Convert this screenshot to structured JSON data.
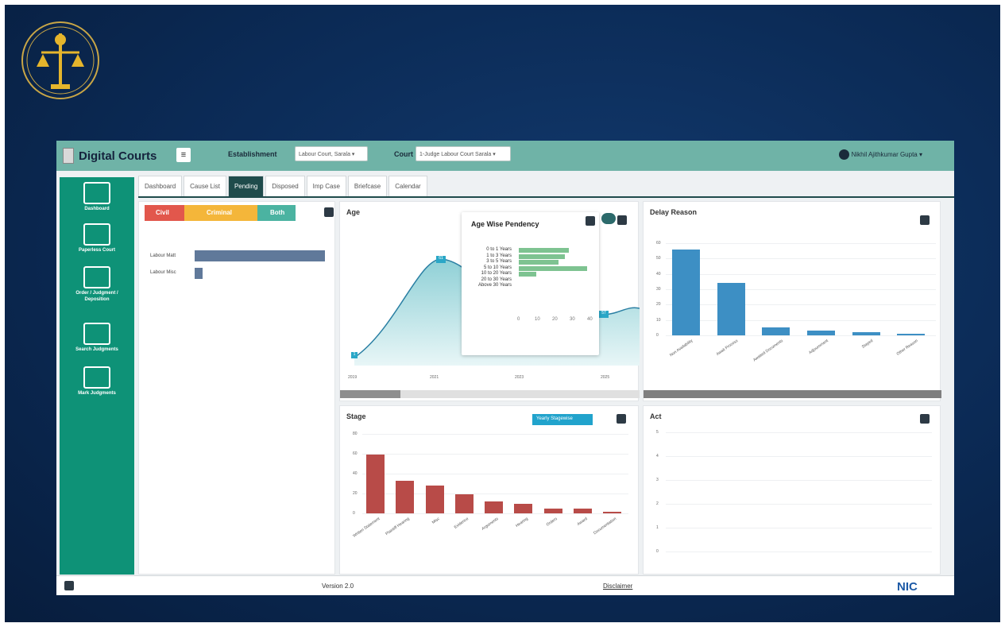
{
  "app": {
    "title": "Digital Courts",
    "version": "Version 2.0",
    "disclaimer": "Disclaimer",
    "footer_logo": "NIC"
  },
  "header": {
    "establishment_label": "Establishment",
    "establishment_value": "Labour Court, Sarala ▾",
    "court_label": "Court",
    "court_value": "1-Judge Labour Court Sarala ▾",
    "user_name": "Nikhil Ajithkumar Gupta ▾"
  },
  "sidebar": {
    "items": [
      {
        "label": "Dashboard",
        "icon": "dashboard-icon"
      },
      {
        "label": "Paperless Court",
        "icon": "paperless-court-icon"
      },
      {
        "label": "Order / Judgment / Deposition",
        "icon": "order-icon"
      },
      {
        "label": "Search Judgments",
        "icon": "search-judgments-icon"
      },
      {
        "label": "Mark Judgments",
        "icon": "mark-judgments-icon"
      }
    ]
  },
  "tabs": [
    {
      "label": "Dashboard",
      "icon": "dashboard-tab-icon"
    },
    {
      "label": "Cause List",
      "icon": "list-icon"
    },
    {
      "label": "Pending",
      "icon": "pending-icon"
    },
    {
      "label": "Disposed",
      "icon": "disposed-icon"
    },
    {
      "label": "Imp Case",
      "icon": "star-icon"
    },
    {
      "label": "Briefcase",
      "icon": "briefcase-icon"
    },
    {
      "label": "Calendar",
      "icon": "calendar-icon"
    }
  ],
  "case_type_panel": {
    "chips": [
      "Civil",
      "Criminal",
      "Both"
    ],
    "rows": [
      {
        "label": "Labour Matt",
        "value_fraction": 1.0
      },
      {
        "label": "Labour Misc",
        "value_fraction": 0.06
      }
    ]
  },
  "age_panel": {
    "title": "Age",
    "x_ticks": [
      "2019",
      "2021",
      "2023",
      "2025"
    ],
    "point_labels": [
      "1",
      "61",
      "57"
    ]
  },
  "tooltip": {
    "title": "Age Wise Pendency",
    "rows": [
      {
        "label": "0 to 1 Years",
        "value_fraction": 0.73
      },
      {
        "label": "1 to 3 Years",
        "value_fraction": 0.68
      },
      {
        "label": "3 to 5 Years",
        "value_fraction": 0.58
      },
      {
        "label": "5 to 10 Years",
        "value_fraction": 1.0
      },
      {
        "label": "10 to 20 Years",
        "value_fraction": 0.25
      },
      {
        "label": "20 to 30 Years",
        "value_fraction": 0
      },
      {
        "label": "Above 30 Years",
        "value_fraction": 0
      }
    ],
    "axis_ticks": [
      "0",
      "10",
      "20",
      "30",
      "40"
    ]
  },
  "delay_panel": {
    "title": "Delay Reason",
    "y_ticks": [
      "0",
      "10",
      "20",
      "30",
      "40",
      "50",
      "60"
    ],
    "values": [
      56,
      34,
      5,
      3,
      2,
      1
    ],
    "categories": [
      "Non Availability",
      "Await Process",
      "Awaited Documents",
      "Adjournment",
      "Stayed",
      "Other Reason"
    ]
  },
  "stage_panel": {
    "title": "Stage",
    "toggle_label": "Yearly Stagewise",
    "y_ticks": [
      "0",
      "20",
      "40",
      "60",
      "80"
    ],
    "values": [
      59,
      33,
      28,
      19,
      12,
      10,
      5,
      5,
      2
    ],
    "categories": [
      "Written Statement",
      "Plaintiff Hearing",
      "Misc",
      "Evidence",
      "Arguments",
      "Hearing",
      "Orders",
      "Award",
      "Documentation"
    ]
  },
  "act_panel": {
    "title": "Act",
    "y_ticks": [
      "0",
      "1",
      "2",
      "3",
      "4",
      "5"
    ]
  },
  "colors": {
    "teal_header": "#6fb3a7",
    "sidebar": "#0e9277",
    "bar_blue": "#3d8fc4",
    "bar_red": "#b84b48",
    "civil": "#e2574c",
    "criminal": "#f4b63a",
    "both": "#4bb3a1"
  }
}
